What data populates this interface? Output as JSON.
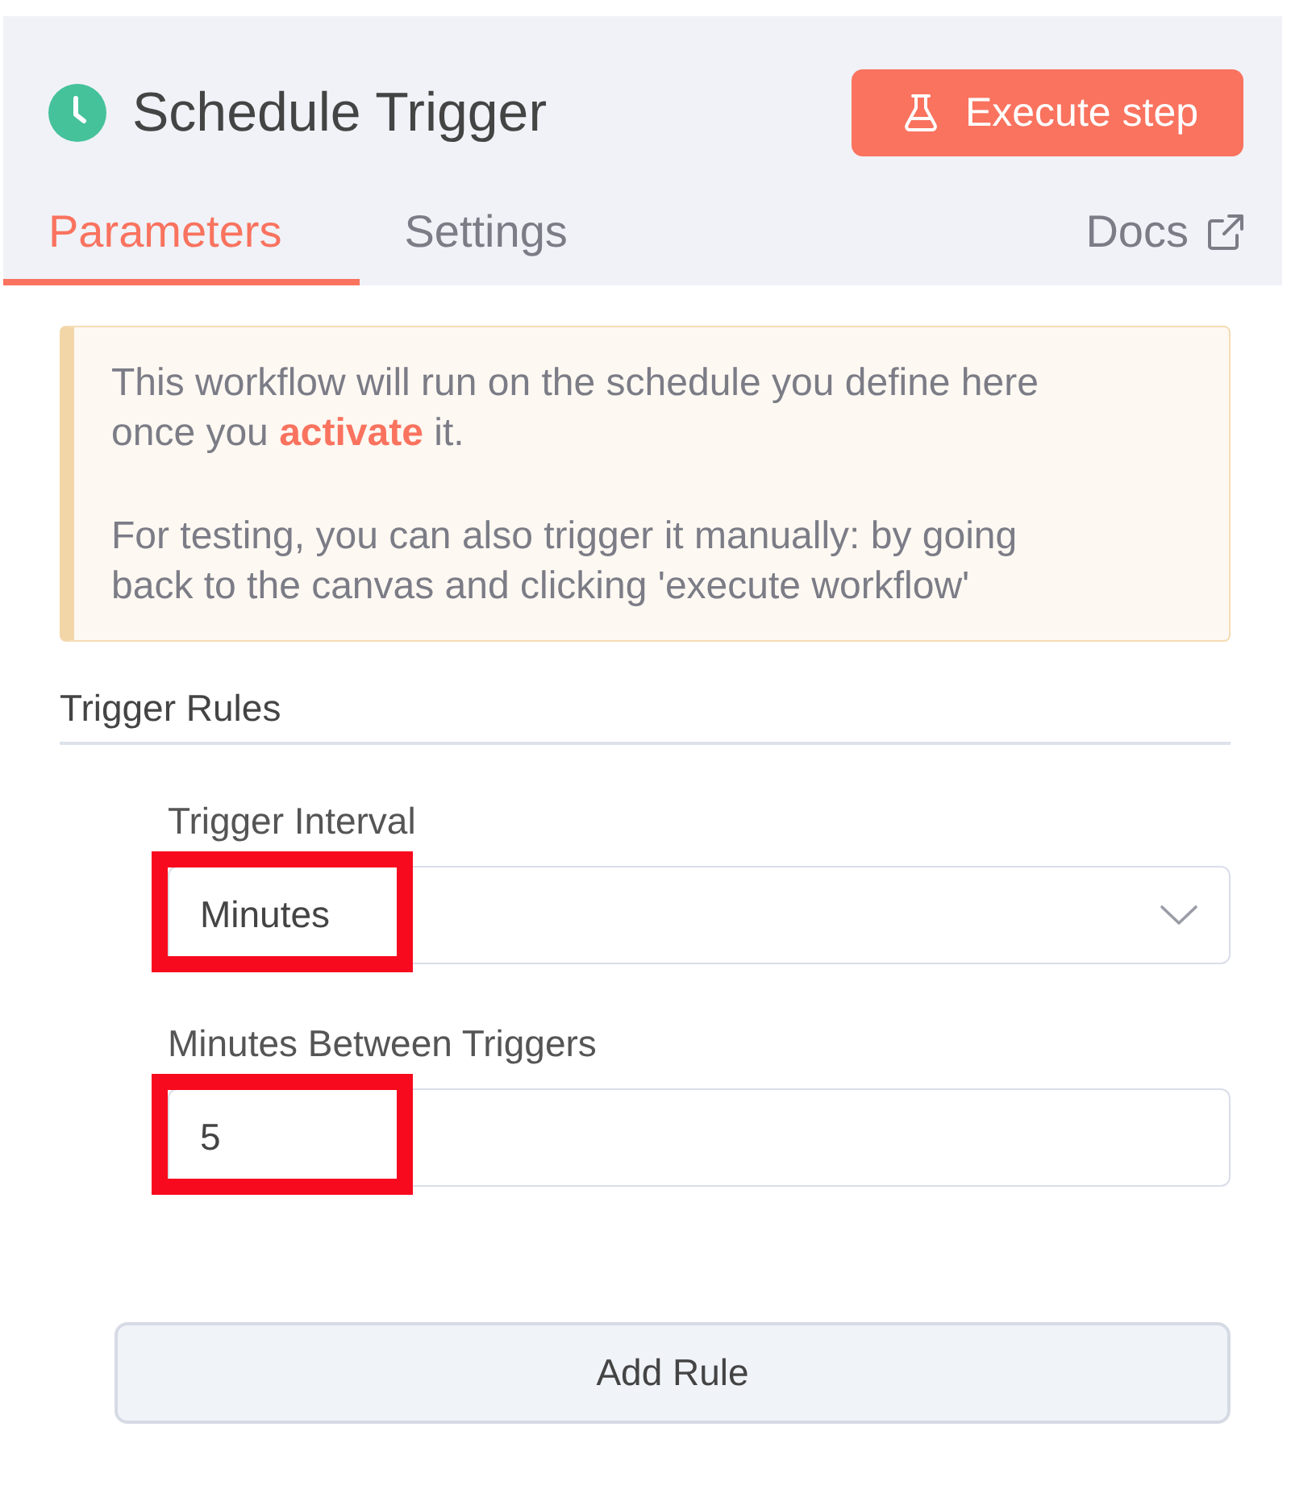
{
  "header": {
    "title": "Schedule Trigger",
    "execute_button": "Execute step"
  },
  "tabs": [
    {
      "label": "Parameters",
      "selected": true
    },
    {
      "label": "Settings",
      "selected": false
    }
  ],
  "docs_link": "Docs",
  "notice": {
    "paragraphs": [
      "This workflow will run on the schedule you define here once you **activate** it.",
      "For testing, you can also trigger it manually: by going back to the canvas and clicking 'execute workflow'"
    ]
  },
  "section_title": "Trigger Rules",
  "fields": [
    {
      "kind": "select",
      "label": "Trigger Interval",
      "value": "Minutes",
      "highlighted": true
    },
    {
      "kind": "number",
      "label": "Minutes Between Triggers",
      "value": "5",
      "highlighted": true
    }
  ],
  "add_button": "Add Rule"
}
